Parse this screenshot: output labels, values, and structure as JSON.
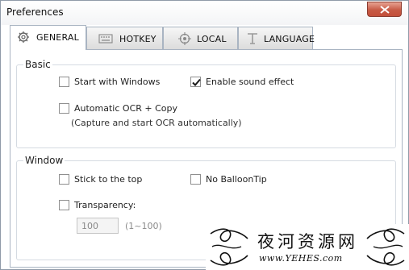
{
  "window": {
    "title": "Preferences"
  },
  "tabs": [
    {
      "label": "GENERAL",
      "icon": "gear-icon",
      "active": true
    },
    {
      "label": "HOTKEY",
      "icon": "keyboard-icon",
      "active": false
    },
    {
      "label": "LOCAL",
      "icon": "target-icon",
      "active": false
    },
    {
      "label": "LANGUAGE",
      "icon": "text-icon",
      "active": false
    }
  ],
  "basic": {
    "legend": "Basic",
    "start_with_windows": {
      "label": "Start with Windows",
      "checked": false
    },
    "enable_sound": {
      "label": "Enable sound effect",
      "checked": true
    },
    "auto_ocr": {
      "label": "Automatic OCR + Copy",
      "checked": false
    },
    "auto_ocr_hint": "(Capture and start OCR automatically)"
  },
  "window_group": {
    "legend": "Window",
    "stick_top": {
      "label": "Stick to the top",
      "checked": false
    },
    "no_balloon": {
      "label": "No BalloonTip",
      "checked": false
    },
    "transparency": {
      "label": "Transparency:",
      "checked": false
    },
    "transparency_value": "100",
    "transparency_range": "(1~100)"
  },
  "watermark": {
    "title": "夜河资源网",
    "url": "www.YEHES.com"
  },
  "colors": {
    "checkmark": "#1a1a1a",
    "close_button": "#c75a45",
    "border": "#a9b4c2"
  }
}
